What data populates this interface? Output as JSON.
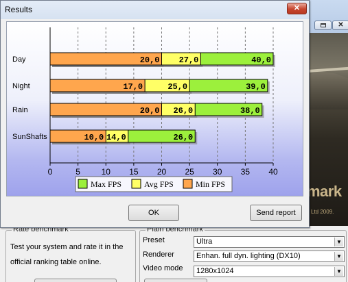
{
  "window": {
    "title": "Results",
    "close_glyph": "✕"
  },
  "background": {
    "restore_glyph": "",
    "close_glyph": "✕",
    "art_logo": "mark",
    "art_copyright": "Ltd 2009.",
    "rate_benchmark": {
      "title": "Rate benchmark",
      "text": "Test your system and rate it in the official ranking table online."
    },
    "plain_benchmark": {
      "title": "Plain benchmark",
      "fields": [
        {
          "label": "Preset",
          "value": "Ultra"
        },
        {
          "label": "Renderer",
          "value": "Enhan. full dyn. lighting (DX10)"
        },
        {
          "label": "Video mode",
          "value": "1280x1024"
        }
      ],
      "arrow_glyph": "▼"
    }
  },
  "chart_data": {
    "type": "bar",
    "orientation": "horizontal",
    "stacked": "overlaid",
    "categories": [
      "Day",
      "Night",
      "Rain",
      "SunShafts"
    ],
    "series": [
      {
        "name": "Max FPS",
        "color": "#9cf03c",
        "values": [
          40,
          39,
          38,
          26
        ],
        "labels": [
          "40,0",
          "39,0",
          "38,0",
          "26,0"
        ]
      },
      {
        "name": "Avg FPS",
        "color": "#ffff66",
        "values": [
          27,
          25,
          26,
          14
        ],
        "labels": [
          "27,0",
          "25,0",
          "26,0",
          "14,0"
        ]
      },
      {
        "name": "Min FPS",
        "color": "#ffa64d",
        "values": [
          20,
          17,
          20,
          10
        ],
        "labels": [
          "20,0",
          "17,0",
          "20,0",
          "10,0"
        ]
      }
    ],
    "xlim": [
      0,
      40
    ],
    "xticks": [
      "0",
      "5",
      "10",
      "15",
      "20",
      "25",
      "30",
      "35",
      "40"
    ],
    "grid": "vertical-dashed",
    "legend_position": "bottom"
  },
  "buttons": {
    "ok": "OK",
    "send_report": "Send report"
  }
}
